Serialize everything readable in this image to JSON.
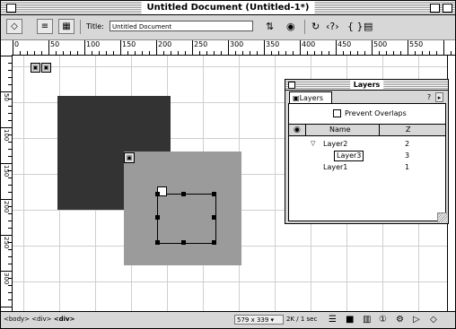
{
  "window": {
    "title": "Untitled Document (Untitled-1*)"
  },
  "toolbar": {
    "title_label": "Title:",
    "title_value": "Untitled Document",
    "buttons": [
      "layout-view-icon",
      "code-view-icon",
      "design-view-icon"
    ],
    "icons": [
      "file-management-icon",
      "preview-icon",
      "refresh-icon",
      "code-navigation-icon",
      "view-options-icon"
    ]
  },
  "ruler": {
    "h_labels": [
      "0",
      "50",
      "100",
      "150",
      "200",
      "250",
      "300",
      "350",
      "400",
      "450",
      "500",
      "550"
    ],
    "v_labels": [
      "50",
      "100",
      "150",
      "200",
      "250",
      "300"
    ]
  },
  "layers_panel": {
    "title": "Layers",
    "tab_label": "Layers",
    "help_label": "?",
    "prevent_overlaps_label": "Prevent Overlaps",
    "prevent_overlaps_checked": false,
    "columns": {
      "name": "Name",
      "z": "Z"
    },
    "rows": [
      {
        "name": "Layer2",
        "z": "2",
        "expanded": true
      },
      {
        "name": "Layer3",
        "z": "3"
      },
      {
        "name": "Layer1",
        "z": "1"
      }
    ]
  },
  "statusbar": {
    "tags": [
      "<body>",
      "<div>",
      "<div>"
    ],
    "window_size": "579 x 339",
    "download_time": "2K / 1 sec",
    "launcher_icons": [
      "site-icon",
      "assets-icon",
      "html-styles-icon",
      "css-styles-icon",
      "behaviors-icon",
      "history-icon",
      "code-inspector-icon"
    ]
  }
}
